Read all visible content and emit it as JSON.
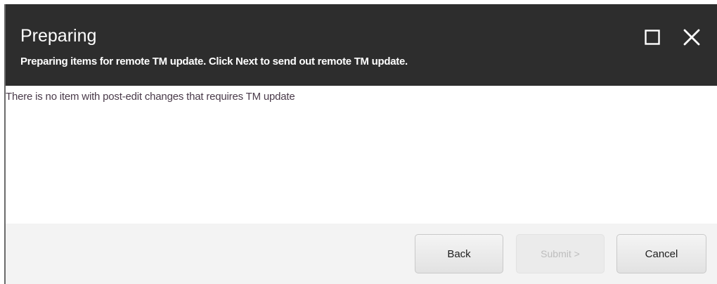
{
  "dialog": {
    "title": "Preparing",
    "subtitle": "Preparing items for remote TM update. Click Next to send out remote TM update.",
    "maximize_icon": "maximize-icon",
    "close_icon": "close-icon"
  },
  "content": {
    "message": "There is no item with post-edit changes that requires TM update"
  },
  "footer": {
    "back_label": "Back",
    "submit_label": "Submit >",
    "submit_enabled": false,
    "cancel_label": "Cancel"
  },
  "colors": {
    "header_bg": "#2d2d2d",
    "footer_bg": "#f3f3f3",
    "disabled_text": "#bdbdbd"
  }
}
